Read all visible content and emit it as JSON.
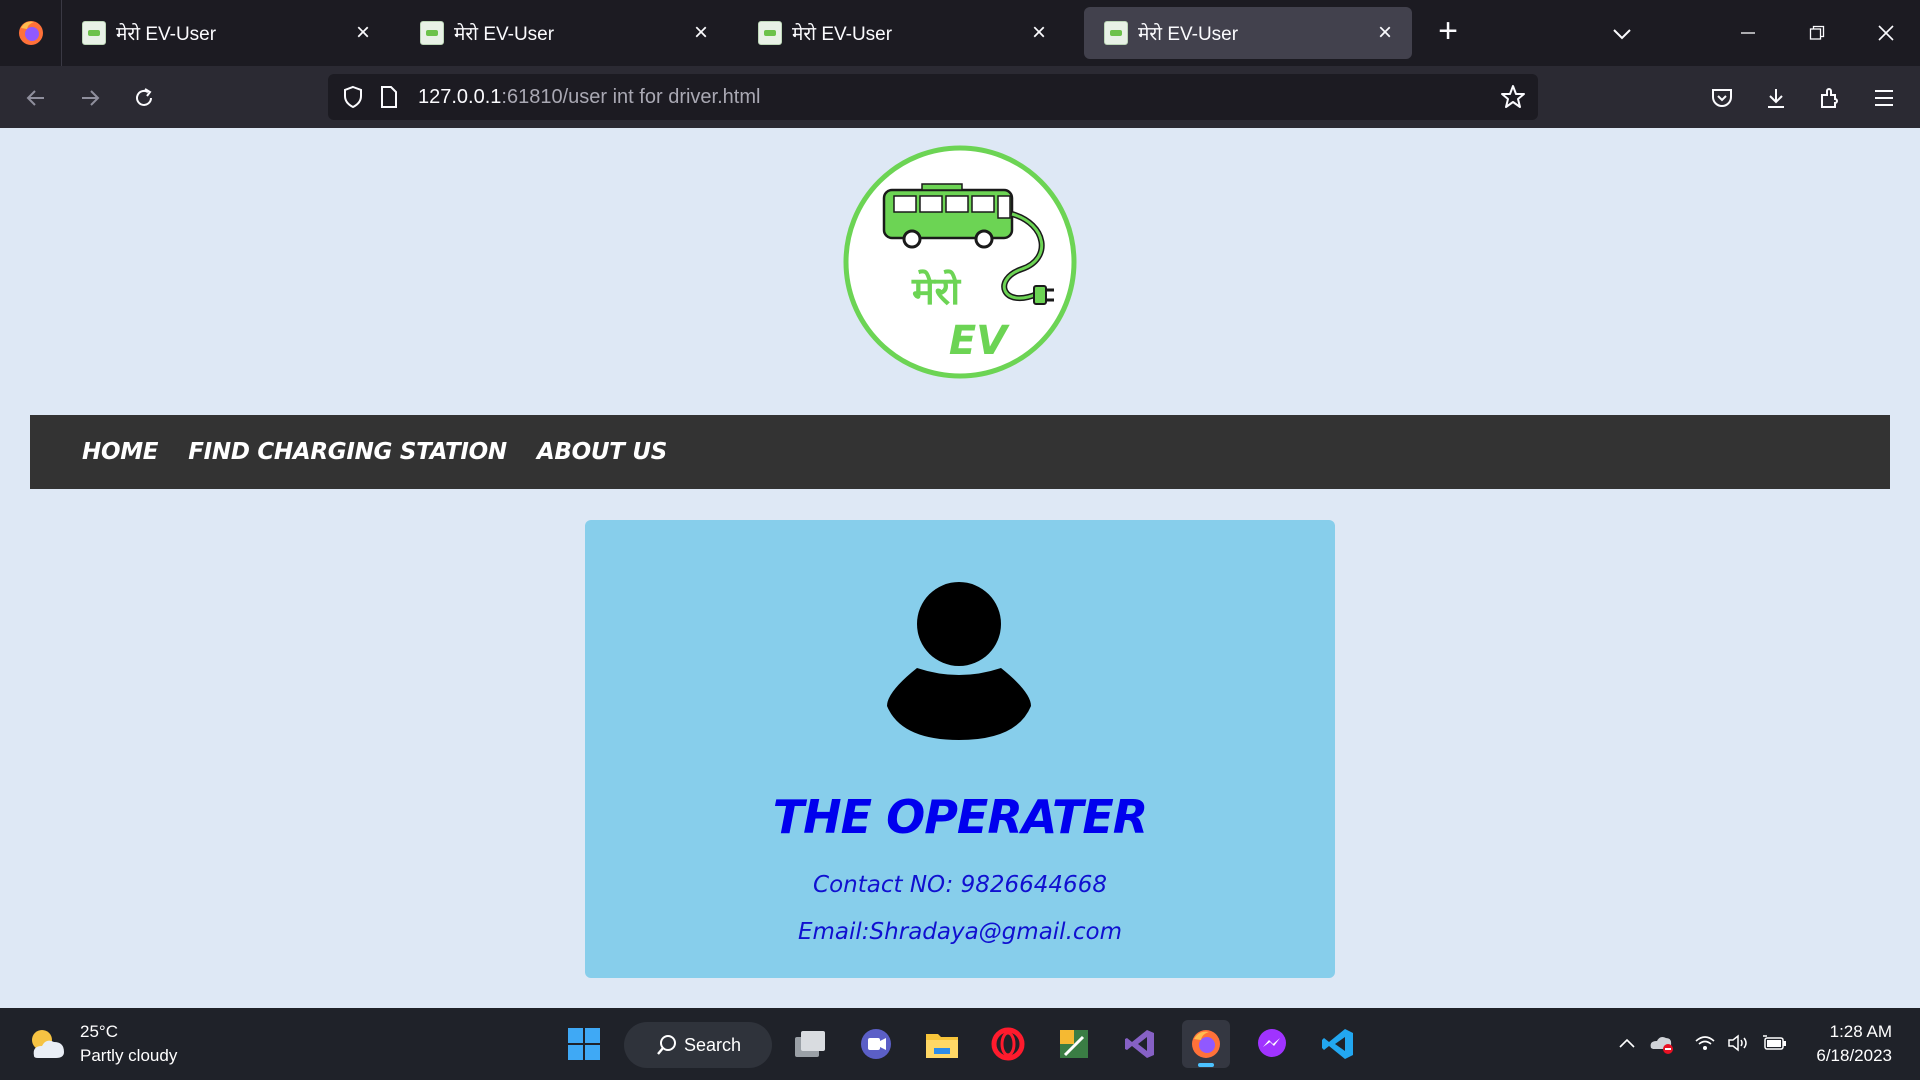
{
  "browser": {
    "tabs": [
      {
        "title": "मेरो EV-User",
        "active": false
      },
      {
        "title": "मेरो EV-User",
        "active": false
      },
      {
        "title": "मेरो EV-User",
        "active": false
      },
      {
        "title": "मेरो EV-User",
        "active": true
      }
    ],
    "url_host": "127.0.0.1",
    "url_rest": ":61810/user int for driver.html"
  },
  "site": {
    "logo": {
      "line1": "मेरो",
      "line2": "EV"
    },
    "nav": [
      "HOME",
      "FIND CHARGING STATION",
      "ABOUT US"
    ],
    "operator": {
      "name": "THE OPERATER",
      "contact": "Contact NO: 9826644668",
      "email": "Email:Shradaya@gmail.com"
    }
  },
  "taskbar": {
    "weather_temp": "25°C",
    "weather_desc": "Partly cloudy",
    "search_label": "Search",
    "apps": [
      "start-icon",
      "task-view-icon",
      "teams-icon",
      "file-explorer-icon",
      "opera-icon",
      "photo-editor-icon",
      "visual-studio-icon",
      "firefox-icon",
      "messenger-icon",
      "vscode-icon"
    ],
    "time": "1:28 AM",
    "date": "6/18/2023"
  },
  "colors": {
    "page_bg": "#dee8f5",
    "nav_bg": "#333333",
    "card_bg": "#87ceeb",
    "operator_text": "#0000ee",
    "logo_green": "#6cd454"
  }
}
